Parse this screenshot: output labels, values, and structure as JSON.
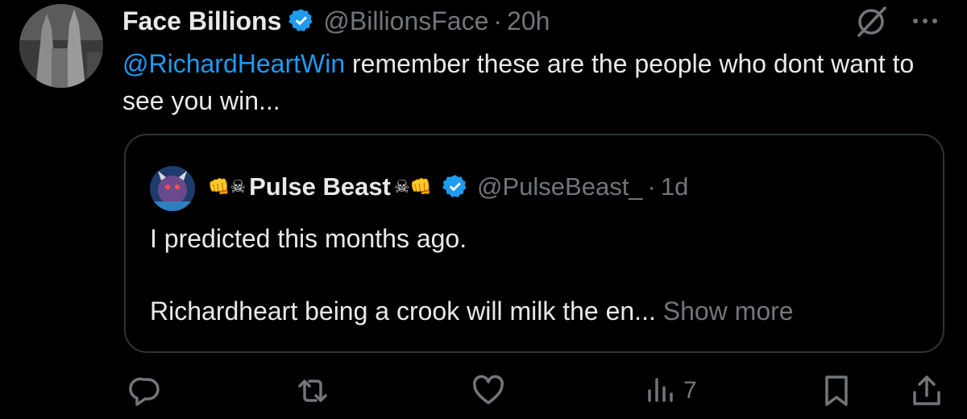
{
  "tweet": {
    "display_name": "Face Billions",
    "handle": "@BillionsFace",
    "separator": "·",
    "time": "20h",
    "mention": "@RichardHeartWin",
    "text": " remember these are the people who dont want to see you win..."
  },
  "quote": {
    "prefix_emoji": "👊☠",
    "display_name": "Pulse Beast",
    "suffix_emoji": "☠👊",
    "handle": "@PulseBeast_",
    "separator": "·",
    "time": "1d",
    "line1": "I predicted this months ago.",
    "line2": "Richardheart being a crook will milk the en...",
    "show_more": "Show more"
  },
  "actions": {
    "views_count": "7"
  },
  "icons": {
    "verified": "verified-badge-icon",
    "grok": "grok-icon",
    "more": "more-icon",
    "reply": "reply-icon",
    "retweet": "retweet-icon",
    "like": "like-icon",
    "views": "views-icon",
    "bookmark": "bookmark-icon",
    "share": "share-icon"
  },
  "colors": {
    "background": "#000000",
    "text": "#e7e9ea",
    "muted": "#71767b",
    "accent": "#1d9bf0",
    "border": "#2f3336"
  }
}
